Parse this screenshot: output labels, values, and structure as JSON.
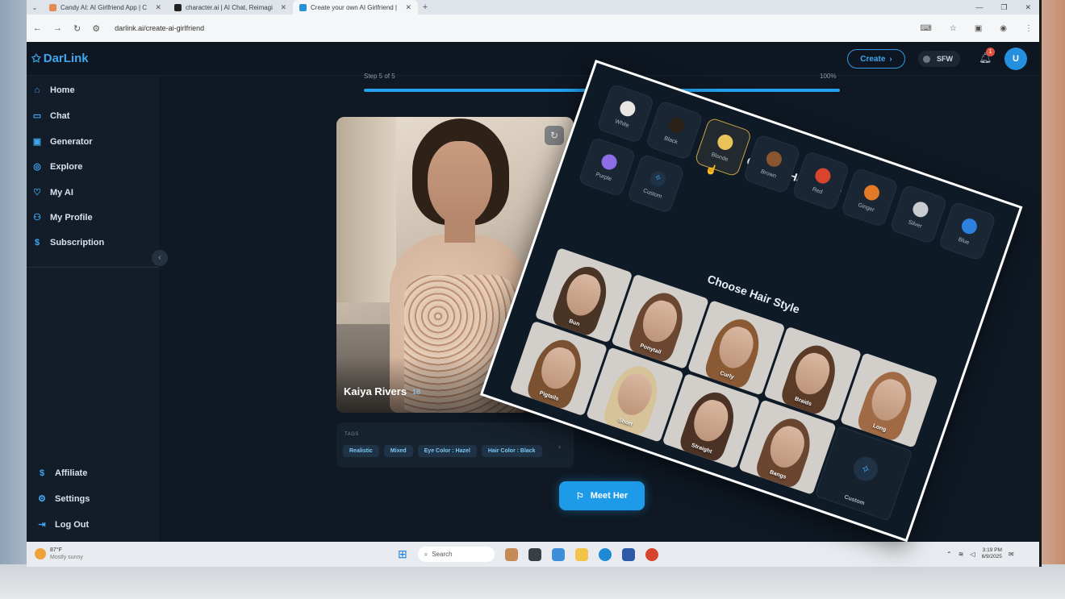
{
  "browser": {
    "tabs": [
      {
        "title": "Candy AI: AI Girlfriend App | C",
        "active": false
      },
      {
        "title": "character.ai | AI Chat, Reimagi",
        "active": false
      },
      {
        "title": "Create your own AI Girlfriend |",
        "active": true
      }
    ],
    "url": "darlink.ai/create-ai-girlfriend"
  },
  "app": {
    "logo": "DarLink",
    "create_label": "Create",
    "sfw_label": "SFW",
    "notification_count": "1",
    "avatar_initial": "U"
  },
  "sidebar": {
    "items": [
      {
        "label": "Home",
        "icon": "home-icon"
      },
      {
        "label": "Chat",
        "icon": "chat-icon"
      },
      {
        "label": "Generator",
        "icon": "generator-icon"
      },
      {
        "label": "Explore",
        "icon": "explore-icon"
      },
      {
        "label": "My AI",
        "icon": "heart-icon"
      },
      {
        "label": "My Profile",
        "icon": "user-icon"
      },
      {
        "label": "Subscription",
        "icon": "dollar-icon"
      }
    ],
    "bottom_items": [
      {
        "label": "Affiliate",
        "icon": "dollar-icon"
      },
      {
        "label": "Settings",
        "icon": "gear-icon"
      },
      {
        "label": "Log Out",
        "icon": "logout-icon"
      }
    ]
  },
  "main": {
    "step_label": "Step 5 of 5",
    "progress_label": "100%",
    "progress": 1.0,
    "character_name": "Kaiya Rivers",
    "character_age": "18",
    "tags_title": "TAGS",
    "tags": [
      "Realistic",
      "Mixed",
      "Eye Color : Hazel",
      "Hair Color : Black"
    ],
    "meet_button": "Meet Her"
  },
  "overlay": {
    "hair_color_title": "Choose Hair Color",
    "hair_colors": [
      {
        "label": "White",
        "color": "#e9e6e2"
      },
      {
        "label": "Black",
        "color": "#2b2118"
      },
      {
        "label": "Blonde",
        "color": "#e9c35a"
      },
      {
        "label": "Brown",
        "color": "#8a5630"
      },
      {
        "label": "Red",
        "color": "#d9452c"
      },
      {
        "label": "Ginger",
        "color": "#e37a28"
      },
      {
        "label": "Silver",
        "color": "#c9ccd0"
      },
      {
        "label": "Blue",
        "color": "#2d7fe0"
      },
      {
        "label": "Purple",
        "color": "#8e6ee6"
      },
      {
        "label": "Custom",
        "color": "#1f3246"
      }
    ],
    "selected_color": "Blonde",
    "hair_style_title": "Choose Hair Style",
    "hair_styles": [
      {
        "label": "Bun",
        "hair": "#4a3425"
      },
      {
        "label": "Ponytail",
        "hair": "#6b4630"
      },
      {
        "label": "Curly",
        "hair": "#8a5a34"
      },
      {
        "label": "Braids",
        "hair": "#5a3b28"
      },
      {
        "label": "Long",
        "hair": "#a06a45"
      },
      {
        "label": "Pigtails",
        "hair": "#7a5232"
      },
      {
        "label": "Short",
        "hair": "#d7c39a"
      },
      {
        "label": "Straight",
        "hair": "#4b3224"
      },
      {
        "label": "Bangs",
        "hair": "#6a4530"
      },
      {
        "label": "Custom",
        "hair": ""
      }
    ]
  },
  "taskbar": {
    "weather_temp": "87°F",
    "weather_desc": "Mostly sunny",
    "search_placeholder": "Search",
    "time": "3:19 PM",
    "date": "6/9/2025"
  }
}
